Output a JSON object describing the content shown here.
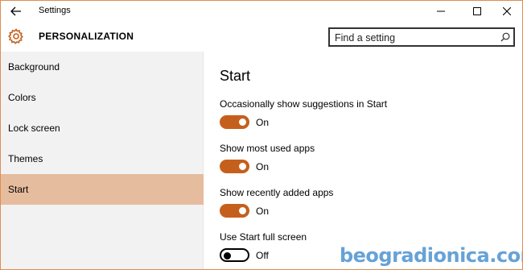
{
  "window": {
    "title": "Settings",
    "controls": [
      "minimize",
      "maximize",
      "close"
    ]
  },
  "header": {
    "section_title": "PERSONALIZATION",
    "section_icon": "gear-icon",
    "search_placeholder": "Find a setting"
  },
  "sidebar": {
    "items": [
      {
        "label": "Background",
        "active": false
      },
      {
        "label": "Colors",
        "active": false
      },
      {
        "label": "Lock screen",
        "active": false
      },
      {
        "label": "Themes",
        "active": false
      },
      {
        "label": "Start",
        "active": true
      }
    ]
  },
  "main": {
    "heading": "Start",
    "settings": [
      {
        "label": "Occasionally show suggestions in Start",
        "state": "On",
        "on": true
      },
      {
        "label": "Show most used apps",
        "state": "On",
        "on": true
      },
      {
        "label": "Show recently added apps",
        "state": "On",
        "on": true
      },
      {
        "label": "Use Start full screen",
        "state": "Off",
        "on": false
      }
    ]
  },
  "watermark": "beogradionica.com",
  "colors": {
    "accent": "#c5601c",
    "active_nav": "#e6bc9e",
    "window_border": "#e08c52",
    "sidebar_bg": "#f2f2f2"
  }
}
